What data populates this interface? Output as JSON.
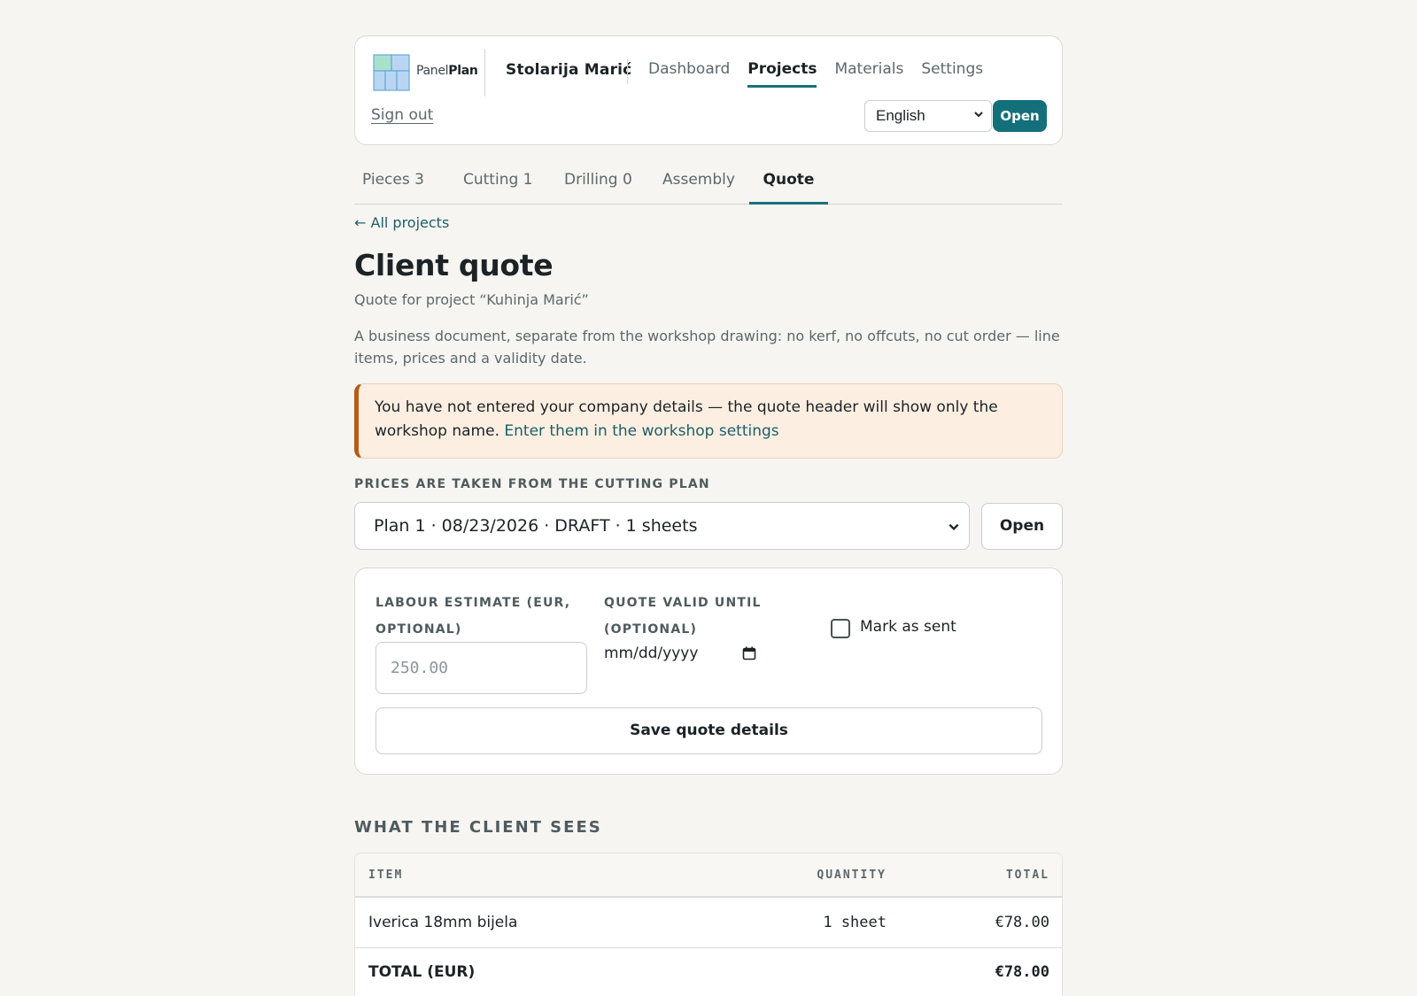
{
  "header": {
    "logo_text_light": "Panel",
    "logo_text_bold": "Plan",
    "workshop_name": "Stolarija Marić",
    "nav": [
      {
        "label": "Dashboard",
        "active": false
      },
      {
        "label": "Projects",
        "active": true
      },
      {
        "label": "Materials",
        "active": false
      },
      {
        "label": "Settings",
        "active": false
      }
    ],
    "sign_out": "Sign out",
    "language": "English",
    "open_button": "Open"
  },
  "tabs": [
    {
      "label": "Pieces 3",
      "active": false
    },
    {
      "label": "Cutting 1",
      "active": false
    },
    {
      "label": "Drilling 0",
      "active": false
    },
    {
      "label": "Assembly",
      "active": false
    },
    {
      "label": "Quote",
      "active": true
    }
  ],
  "page": {
    "back_link": "← All projects",
    "title": "Client quote",
    "subtitle": "Quote for project “Kuhinja Marić”",
    "description": "A business document, separate from the workshop drawing: no kerf, no offcuts, no cut order — line items, prices and a validity date."
  },
  "notice": {
    "text": "You have not entered your company details — the quote header will show only the workshop name.",
    "link": "Enter them in the workshop settings"
  },
  "plan": {
    "label": "PRICES ARE TAKEN FROM THE CUTTING PLAN",
    "selected": "Plan 1 · 08/23/2026 · DRAFT · 1 sheets",
    "open_button": "Open"
  },
  "form": {
    "labour_label_line1": "LABOUR ESTIMATE (EUR,",
    "labour_label_line2": "OPTIONAL)",
    "labour_placeholder": "250.00",
    "valid_label_line1": "QUOTE VALID UNTIL",
    "valid_label_line2": "(OPTIONAL)",
    "valid_placeholder": "mm/dd/yyyy",
    "mark_sent_label": "Mark as sent",
    "mark_sent_checked": false,
    "save_button": "Save quote details"
  },
  "client_view": {
    "title": "WHAT THE CLIENT SEES",
    "columns": [
      "ITEM",
      "QUANTITY",
      "TOTAL"
    ],
    "rows": [
      {
        "item": "Iverica 18mm bijela",
        "quantity": "1 sheet",
        "total": "€78.00"
      }
    ],
    "total_label": "TOTAL (EUR)",
    "total_value": "€78.00"
  },
  "colors": {
    "accent": "#13707a",
    "warning_border": "#b35c16",
    "warning_bg": "#fcefe2",
    "page_bg": "#f6f5f1"
  }
}
